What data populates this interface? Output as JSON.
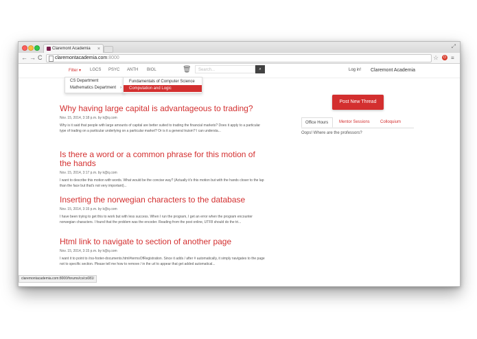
{
  "browser": {
    "tab_title": "Claremont Academia",
    "tab_close": "×",
    "url_host": "claremontacademia.com",
    "url_port": ":8000",
    "back": "←",
    "forward": "→",
    "reload": "C",
    "star": "☆",
    "ext_badge": "O",
    "menu": "≡",
    "fullscreen": "⤢"
  },
  "navbar": {
    "filter_label": "Filter ▾",
    "links": [
      "LGCS",
      "PSYC",
      "ANTH",
      "BIOL"
    ],
    "trash": "🗑",
    "search_placeholder": "Search...",
    "search_button": "⌕",
    "login": "Log in!",
    "brand": "Claremont Academia"
  },
  "filter_menu": {
    "items": [
      "CS Department",
      "Mathematics Department"
    ],
    "arrow": "›",
    "submenu": [
      "Fundamentals of Computer Science",
      "Computation and Logic"
    ]
  },
  "threads": [
    {
      "title": "Why having large capital is advantageous to trading?",
      "meta": "Nov. 15, 2014, 3:18 p.m. by k@q.com",
      "excerpt": "Why is it said that people with large amounts of capital are better suited to trading the financial markets? Does it apply to a particular type of trading on a particular underlying on a particular market? Or is it a general truism? I can understa..."
    },
    {
      "title": "Is there a word or a common phrase for this motion of the hands",
      "meta": "Nov. 15, 2014, 3:17 p.m. by k@q.com",
      "excerpt": "I want to describe this motion with words. What would be the concise way? (Actually it's this motion but with the hands closer to the lap than the face but that's not very important)..."
    },
    {
      "title": "Inserting the norwegian characters to the database",
      "meta": "Nov. 15, 2014, 3:15 p.m. by k@q.com",
      "excerpt": "I have been trying to get this to work but with less success. When I run the program, I get an error when the program encounter norwegian characters. I found that the problem was the encoder. Reading from the post online, UTF8 should do the tri..."
    },
    {
      "title": "Html link to navigate to section of another page",
      "meta": "Nov. 15, 2014, 3:15 p.m. by k@q.com",
      "excerpt": "I want it to point to /rss-footer-documents.html#termsOfRegistration. Since it adds / after # automatically, it simply navigates to the page not to specific section. Please tell me how to remove / in the url to appear that get added automatical..."
    }
  ],
  "sidebar": {
    "post_button": "Post New Thread",
    "tabs": [
      "Office Hours",
      "Mentor Sessions",
      "Colloquium"
    ],
    "empty_message": "Oops! Where are the professors?"
  },
  "status_url": "claremontacademia.com:8000/forums/cs/cs081/"
}
